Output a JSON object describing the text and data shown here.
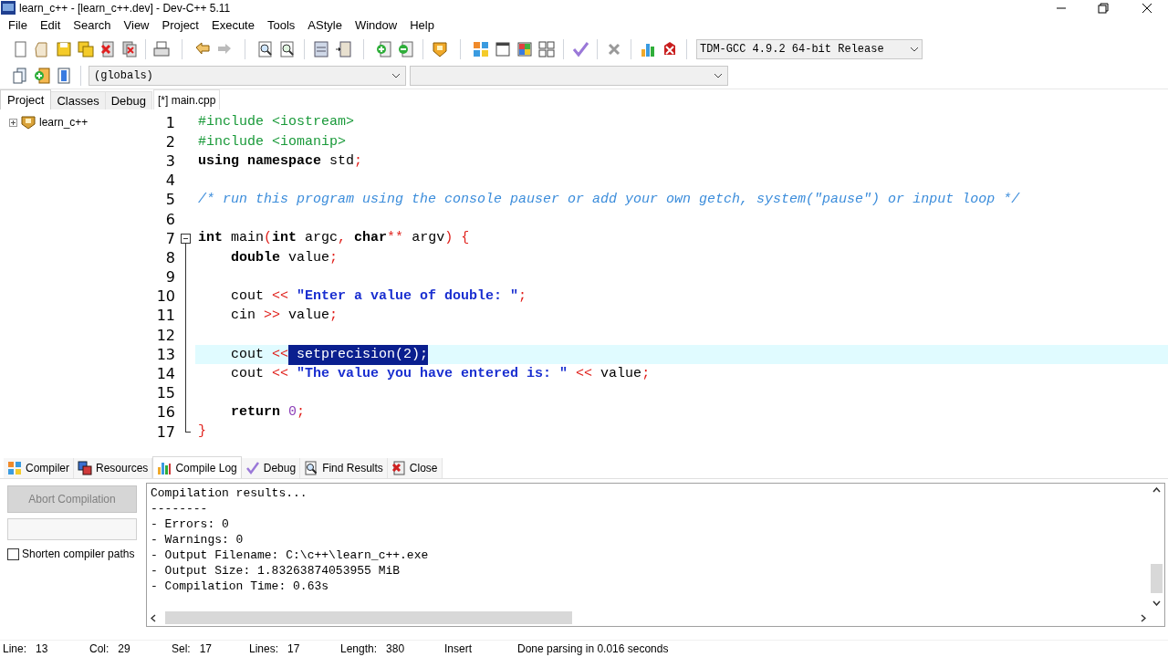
{
  "window": {
    "title": "learn_c++ - [learn_c++.dev] - Dev-C++ 5.11"
  },
  "menu": [
    "File",
    "Edit",
    "Search",
    "View",
    "Project",
    "Execute",
    "Tools",
    "AStyle",
    "Window",
    "Help"
  ],
  "compiler_select": {
    "value": "TDM-GCC 4.9.2 64-bit Release"
  },
  "scope_select": {
    "value": "(globals)"
  },
  "left_tabs": [
    {
      "label": "Project",
      "selected": true
    },
    {
      "label": "Classes",
      "selected": false
    },
    {
      "label": "Debug",
      "selected": false
    }
  ],
  "project_tree": [
    {
      "label": "learn_c++",
      "expanded": false
    }
  ],
  "editor_tabs": [
    {
      "label": "[*] main.cpp",
      "selected": true
    }
  ],
  "code_lines": [
    {
      "number": "1",
      "current": false,
      "fold_start": false,
      "in_fold": false,
      "tokens": [
        {
          "kind": "preproc",
          "text": "#include <iostream>"
        }
      ]
    },
    {
      "number": "2",
      "current": false,
      "fold_start": false,
      "in_fold": false,
      "tokens": [
        {
          "kind": "preproc",
          "text": "#include <iomanip>"
        }
      ]
    },
    {
      "number": "3",
      "current": false,
      "fold_start": false,
      "in_fold": false,
      "tokens": [
        {
          "kind": "keyword",
          "text": "using namespace"
        },
        {
          "kind": "plain",
          "text": " std"
        },
        {
          "kind": "symbol",
          "text": ";"
        }
      ]
    },
    {
      "number": "4",
      "current": false,
      "fold_start": false,
      "in_fold": false
    },
    {
      "number": "5",
      "current": false,
      "fold_start": false,
      "in_fold": false,
      "tokens": [
        {
          "kind": "comment",
          "text": "/* run this program using the console pauser or add your own getch, system(\"pause\") or input loop */"
        }
      ]
    },
    {
      "number": "6",
      "current": false,
      "fold_start": false,
      "in_fold": false
    },
    {
      "number": "7",
      "current": false,
      "fold_start": true,
      "in_fold": false,
      "tokens": [
        {
          "kind": "keyword",
          "text": "int"
        },
        {
          "kind": "plain",
          "text": " main"
        },
        {
          "kind": "symbol",
          "text": "("
        },
        {
          "kind": "keyword",
          "text": "int"
        },
        {
          "kind": "plain",
          "text": " argc"
        },
        {
          "kind": "symbol",
          "text": ","
        },
        {
          "kind": "keyword",
          "text": " char"
        },
        {
          "kind": "symbol",
          "text": "**"
        },
        {
          "kind": "plain",
          "text": " argv"
        },
        {
          "kind": "symbol",
          "text": ") {"
        }
      ]
    },
    {
      "number": "8",
      "current": false,
      "fold_start": false,
      "in_fold": true,
      "tokens": [
        {
          "kind": "keyword",
          "text": "    double"
        },
        {
          "kind": "plain",
          "text": " value"
        },
        {
          "kind": "symbol",
          "text": ";"
        }
      ]
    },
    {
      "number": "9",
      "current": false,
      "fold_start": false,
      "in_fold": true
    },
    {
      "number": "10",
      "current": false,
      "fold_start": false,
      "in_fold": true,
      "tokens": [
        {
          "kind": "plain",
          "text": "    cout "
        },
        {
          "kind": "symbol",
          "text": "<<"
        },
        {
          "kind": "string",
          "text": " \"Enter a value of double: \""
        },
        {
          "kind": "symbol",
          "text": ";"
        }
      ]
    },
    {
      "number": "11",
      "current": false,
      "fold_start": false,
      "in_fold": true,
      "tokens": [
        {
          "kind": "plain",
          "text": "    cin "
        },
        {
          "kind": "symbol",
          "text": ">>"
        },
        {
          "kind": "plain",
          "text": " value"
        },
        {
          "kind": "symbol",
          "text": ";"
        }
      ]
    },
    {
      "number": "12",
      "current": false,
      "fold_start": false,
      "in_fold": true
    },
    {
      "number": "13",
      "current": true,
      "fold_start": false,
      "in_fold": true,
      "tokens": [
        {
          "kind": "plain",
          "text": "    cout "
        },
        {
          "kind": "symbol",
          "text": "<<"
        },
        {
          "kind": "selected",
          "text": " setprecision(2);"
        }
      ]
    },
    {
      "number": "14",
      "current": false,
      "fold_start": false,
      "in_fold": true,
      "tokens": [
        {
          "kind": "plain",
          "text": "    cout "
        },
        {
          "kind": "symbol",
          "text": "<<"
        },
        {
          "kind": "string",
          "text": " \"The value you have entered is: \""
        },
        {
          "kind": "symbol",
          "text": " <<"
        },
        {
          "kind": "plain",
          "text": " value"
        },
        {
          "kind": "symbol",
          "text": ";"
        }
      ]
    },
    {
      "number": "15",
      "current": false,
      "fold_start": false,
      "in_fold": true
    },
    {
      "number": "16",
      "current": false,
      "fold_start": false,
      "in_fold": true,
      "tokens": [
        {
          "kind": "keyword",
          "text": "    return"
        },
        {
          "kind": "number",
          "text": " 0"
        },
        {
          "kind": "symbol",
          "text": ";"
        }
      ]
    },
    {
      "number": "17",
      "current": false,
      "fold_start": false,
      "in_fold": true,
      "tokens": [
        {
          "kind": "symbol",
          "text": "}"
        }
      ]
    }
  ],
  "bottom_tabs": [
    {
      "label": "Compiler",
      "kind": "grid",
      "selected": false
    },
    {
      "label": "Resources",
      "kind": "resources",
      "selected": false
    },
    {
      "label": "Compile Log",
      "kind": "chart",
      "selected": true
    },
    {
      "label": "Debug",
      "kind": "check",
      "selected": false
    },
    {
      "label": "Find Results",
      "kind": "find",
      "selected": false
    },
    {
      "label": "Close",
      "kind": "close",
      "selected": false
    }
  ],
  "abort_button": {
    "label": "Abort Compilation",
    "disabled": true
  },
  "shorten_paths": {
    "label": "Shorten compiler paths",
    "checked": false
  },
  "compile_log": [
    "Compilation results...",
    "--------",
    "- Errors: 0",
    "- Warnings: 0",
    "- Output Filename: C:\\c++\\learn_c++.exe",
    "- Output Size: 1.83263874053955 MiB",
    "- Compilation Time: 0.63s"
  ],
  "status_bar": [
    {
      "label": "Line:",
      "value": "13"
    },
    {
      "label": "Col:",
      "value": "29"
    },
    {
      "label": "Sel:",
      "value": "17"
    },
    {
      "label": "Lines:",
      "value": "17"
    },
    {
      "label": "Length:",
      "value": "380"
    },
    {
      "value": "Insert"
    },
    {
      "value": "Done parsing in 0.016 seconds"
    }
  ]
}
